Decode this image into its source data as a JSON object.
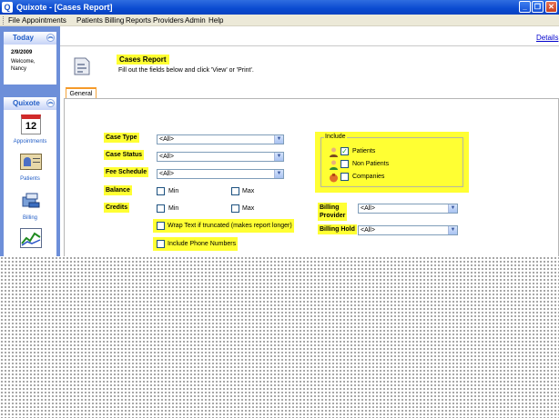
{
  "window": {
    "title": "Quixote - [Cases Report]",
    "minimize": "_",
    "restore": "❐",
    "close": "✕"
  },
  "menu": [
    "File",
    "Appointments",
    "Patients",
    "Billing",
    "Reports",
    "Providers",
    "Admin",
    "Help"
  ],
  "sidebar": {
    "today": {
      "title": "Today",
      "date": "2/9/2009",
      "welcome": "Welcome,",
      "user": "Nancy"
    },
    "quixote": {
      "title": "Quixote",
      "items": [
        {
          "label": "Appointments",
          "icon": "calendar-icon",
          "day": "12"
        },
        {
          "label": "Patients",
          "icon": "patient-card-icon"
        },
        {
          "label": "Billing",
          "icon": "billing-icon"
        },
        {
          "label": "",
          "icon": "chart-icon"
        }
      ]
    }
  },
  "details_link": "Details",
  "report": {
    "title": "Cases Report",
    "subtitle": "Fill out the fields below and click 'View' or 'Print'."
  },
  "tabs": [
    {
      "label": "General",
      "active": true
    }
  ],
  "form": {
    "case_type": {
      "label": "Case Type",
      "value": "<All>"
    },
    "case_status": {
      "label": "Case Status",
      "value": "<All>"
    },
    "fee_schedule": {
      "label": "Fee Schedule",
      "value": "<All>"
    },
    "balance": {
      "label": "Balance",
      "min": "Min",
      "max": "Max"
    },
    "credits": {
      "label": "Credits",
      "min": "Min",
      "max": "Max"
    },
    "wrap_text": {
      "label": "Wrap Text if truncated (makes report longer)",
      "checked": false
    },
    "phone_numbers": {
      "label": "Include Phone Numbers",
      "checked": false
    },
    "billing_provider": {
      "label_line1": "Billing",
      "label_line2": "Provider",
      "value": "<All>"
    },
    "billing_hold": {
      "label": "Billing Hold",
      "value": "<All>"
    }
  },
  "include": {
    "caption": "Include",
    "options": [
      {
        "label": "Patients",
        "checked": true,
        "icon": "patient-person-icon"
      },
      {
        "label": "Non Patients",
        "checked": false,
        "icon": "non-patient-person-icon"
      },
      {
        "label": "Companies",
        "checked": false,
        "icon": "company-icon"
      }
    ]
  },
  "colors": {
    "highlight": "#ffff33",
    "titlebar": "#0a4ad0",
    "sidebar": "#6d8fd9",
    "link": "#0000cc"
  }
}
